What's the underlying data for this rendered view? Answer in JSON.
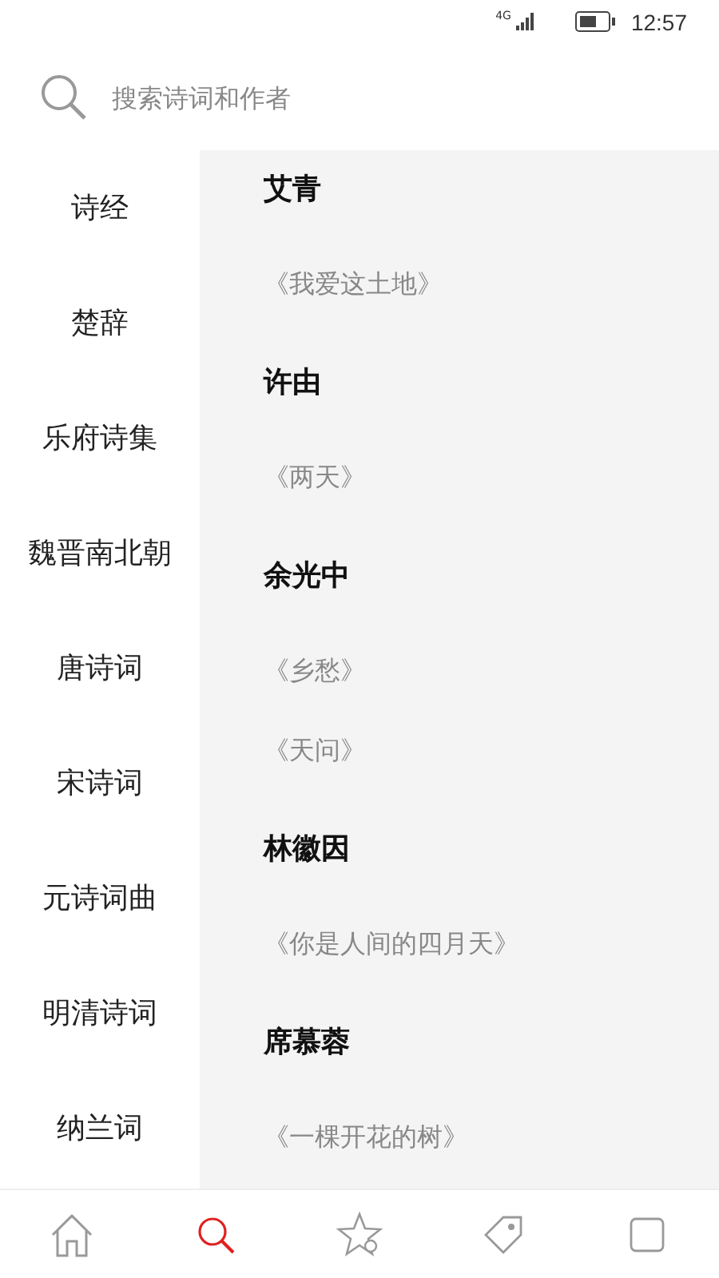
{
  "status_bar": {
    "network": "4G",
    "time": "12:57"
  },
  "search": {
    "placeholder": "搜索诗词和作者"
  },
  "categories": [
    "诗经",
    "楚辞",
    "乐府诗集",
    "魏晋南北朝",
    "唐诗词",
    "宋诗词",
    "元诗词曲",
    "明清诗词",
    "纳兰词"
  ],
  "authors": [
    {
      "name": "艾青",
      "poems": [
        "《我爱这土地》"
      ]
    },
    {
      "name": "许由",
      "poems": [
        "《两天》"
      ]
    },
    {
      "name": "余光中",
      "poems": [
        "《乡愁》",
        "《天问》"
      ]
    },
    {
      "name": "林徽因",
      "poems": [
        "《你是人间的四月天》"
      ]
    },
    {
      "name": "席慕蓉",
      "poems": [
        "《一棵开花的树》"
      ]
    }
  ],
  "nav_tabs": [
    {
      "kind": "home",
      "selected": false
    },
    {
      "kind": "search",
      "selected": true
    },
    {
      "kind": "star",
      "selected": false
    },
    {
      "kind": "tag",
      "selected": false
    },
    {
      "kind": "square",
      "selected": false
    }
  ]
}
